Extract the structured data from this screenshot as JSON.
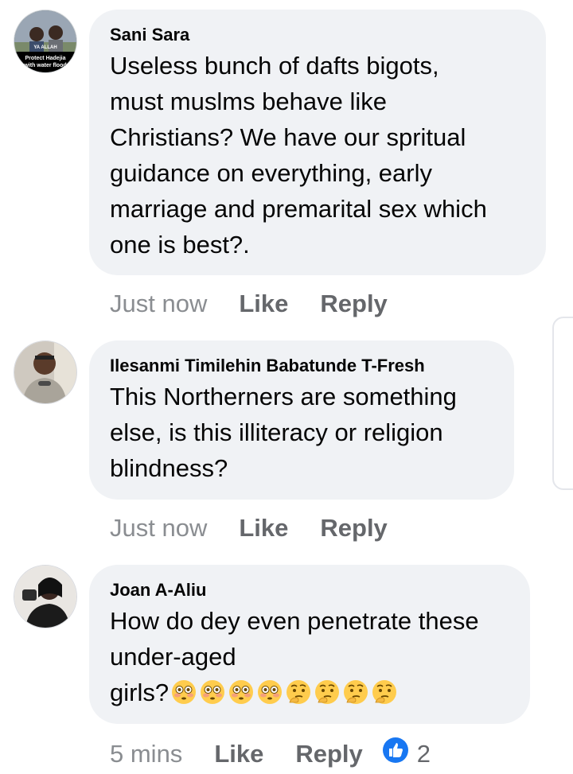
{
  "comments": [
    {
      "author": "Sani Sara",
      "text": "Useless bunch of dafts bigots,\nmust muslms behave like\nChristians? We have our spritual\nguidance on everything, early\nmarriage and premarital sex which\none is best?.",
      "time": "Just now",
      "like_label": "Like",
      "reply_label": "Reply",
      "avatar_caption_1": "Protect Hadejia",
      "avatar_caption_2": "with water flood",
      "avatar_caption_top": "YA ALLAH"
    },
    {
      "author": "Ilesanmi Timilehin Babatunde T-Fresh",
      "text": "This Northerners are something\nelse, is this illiteracy or religion\nblindness?",
      "time": "Just now",
      "like_label": "Like",
      "reply_label": "Reply"
    },
    {
      "author": "Joan A-Aliu",
      "text": "How do dey even penetrate these\nunder-aged\ngirls?",
      "emojis": [
        "flushed-face",
        "flushed-face",
        "flushed-face",
        "flushed-face",
        "thinking-face",
        "thinking-face",
        "thinking-face",
        "thinking-face"
      ],
      "time": "5 mins",
      "like_label": "Like",
      "reply_label": "Reply",
      "reaction_icon": "like-reaction-icon",
      "reaction_count": "2"
    }
  ],
  "colors": {
    "bubble": "#f0f2f5",
    "meta": "#65676b",
    "like_blue": "#1877f2"
  }
}
